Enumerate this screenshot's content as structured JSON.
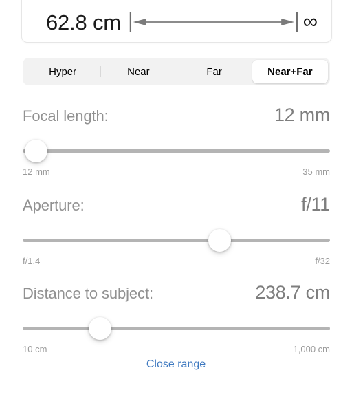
{
  "dof_card": {
    "near_value": "62.8 cm",
    "far_value": "∞",
    "range_arrow_icon": "double-headed-arrow-icon"
  },
  "segmented_control": {
    "options": [
      {
        "label": "Hyper",
        "selected": false
      },
      {
        "label": "Near",
        "selected": false
      },
      {
        "label": "Far",
        "selected": false
      },
      {
        "label": "Near+Far",
        "selected": true
      }
    ]
  },
  "controls": [
    {
      "label": "Focal length:",
      "value": "12 mm",
      "min_label": "12 mm",
      "max_label": "35 mm",
      "percent": 0
    },
    {
      "label": "Aperture:",
      "value": "f/11",
      "min_label": "f/1.4",
      "max_label": "f/32",
      "percent": 64.2
    },
    {
      "label": "Distance to subject:",
      "value": "238.7 cm",
      "min_label": "10 cm",
      "max_label": "1,000 cm",
      "percent": 25.1
    }
  ],
  "footer": {
    "close_range_label": "Close range"
  },
  "colors": {
    "link": "#3e79c0",
    "label_gray": "#919191",
    "value_gray": "#7e7e7e",
    "track_gray": "#b4b4b4",
    "segment_bg": "#f2f2f2"
  }
}
